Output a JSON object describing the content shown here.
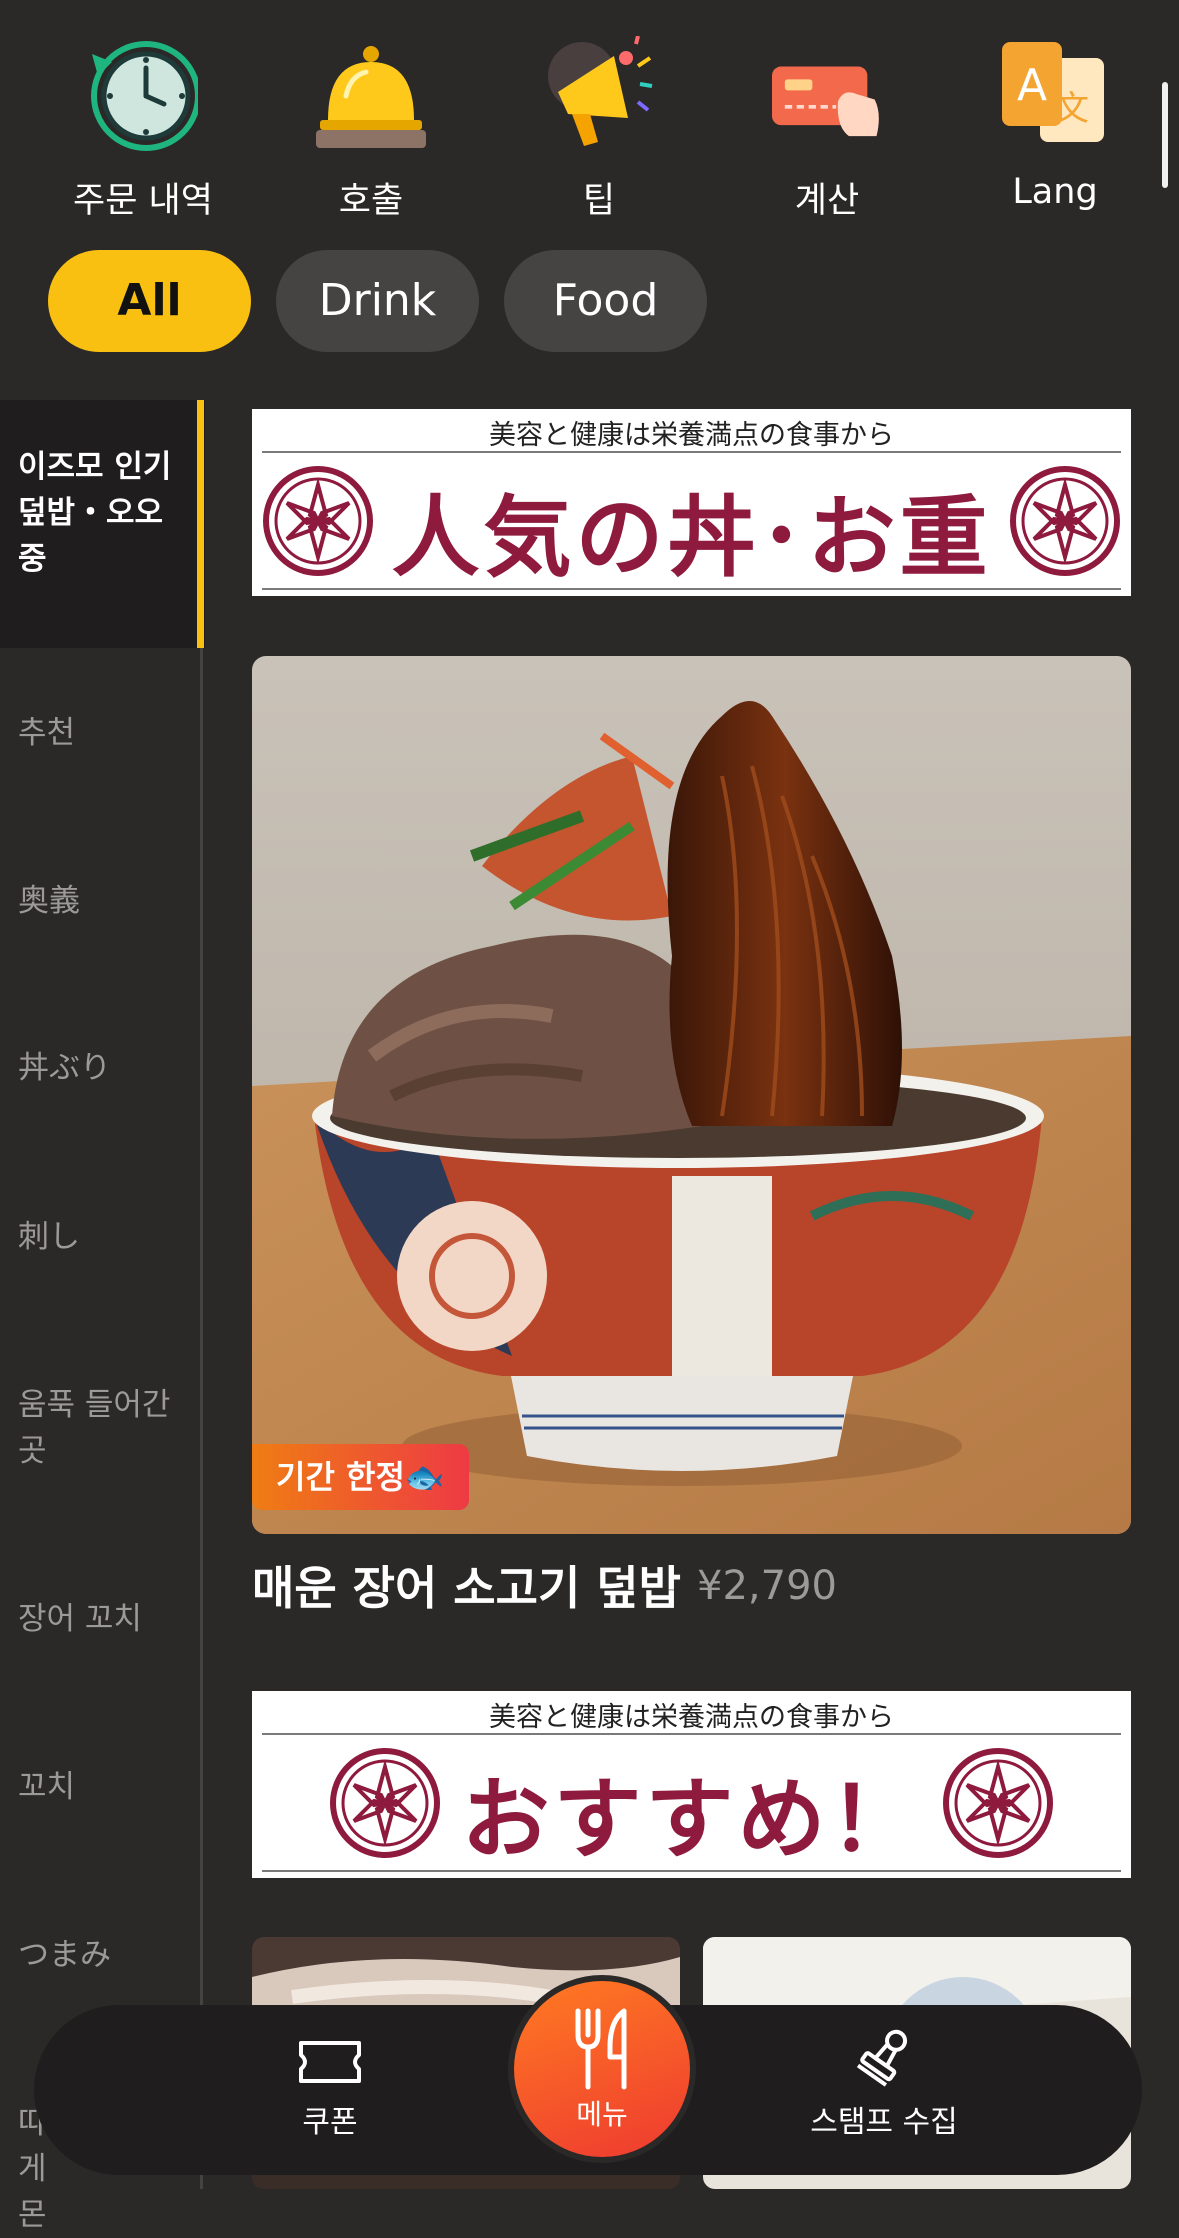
{
  "top_actions": [
    {
      "label": "주문 내역",
      "icon": "order-history-clock-icon"
    },
    {
      "label": "호출",
      "icon": "service-bell-icon"
    },
    {
      "label": "팁",
      "icon": "megaphone-icon"
    },
    {
      "label": "계산",
      "icon": "payment-card-icon"
    },
    {
      "label": "Lang",
      "icon": "language-icon"
    }
  ],
  "filters": [
    {
      "label": "All",
      "active": true
    },
    {
      "label": "Drink",
      "active": false
    },
    {
      "label": "Food",
      "active": false
    }
  ],
  "sidebar": {
    "items": [
      {
        "label": "이즈모 인기 덮밥・오오 중",
        "active": true
      },
      {
        "label": "추천"
      },
      {
        "label": "奥義"
      },
      {
        "label": "丼ぶり"
      },
      {
        "label": "刺し"
      },
      {
        "label": "움푹 들어간 곳"
      },
      {
        "label": "장어 꼬치"
      },
      {
        "label": "꼬치"
      },
      {
        "label": "つまみ"
      },
      {
        "label": "따... 게몬"
      }
    ]
  },
  "banners": [
    {
      "subtitle": "美容と健康は栄養満点の食事から",
      "title": "人気の丼･お重"
    },
    {
      "subtitle": "美容と健康は栄養満点の食事から",
      "title": "おすすめ！"
    }
  ],
  "featured_item": {
    "badge": "기간 한정🐟",
    "name": "매운 장어 소고기 덮밥",
    "price": "¥2,790"
  },
  "bottom_nav": {
    "coupon": "쿠폰",
    "menu": "메뉴",
    "stamp": "스탬프 수집"
  },
  "colors": {
    "accent": "#f9c012",
    "background": "#2b2828",
    "banner_red": "#8e1a3e",
    "menu_button": "#ee3a30"
  }
}
